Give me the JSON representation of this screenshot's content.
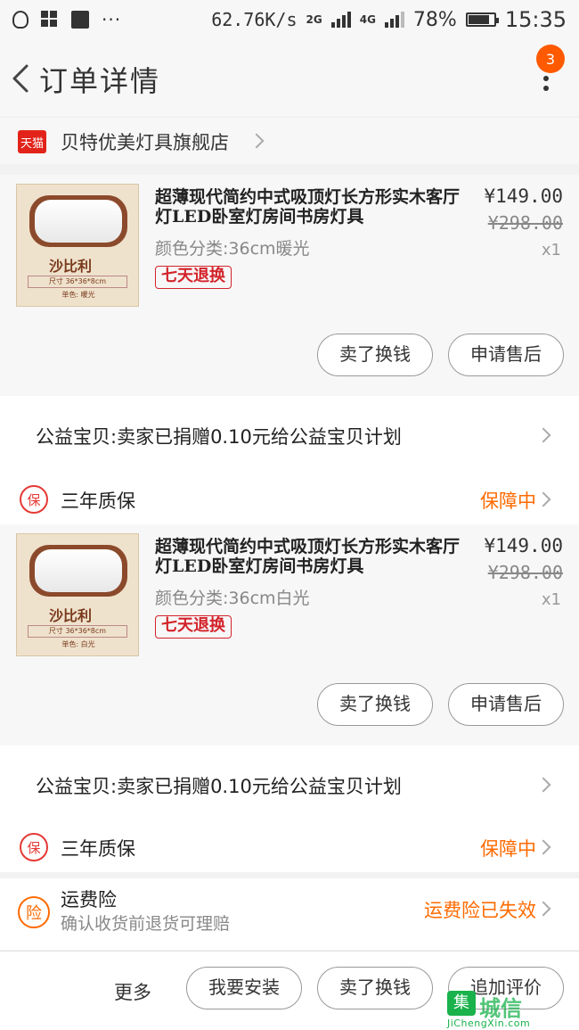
{
  "status_bar": {
    "speed": "62.76K/s",
    "net1": "2G",
    "net2": "4G",
    "battery": "78%",
    "time": "15:35"
  },
  "nav": {
    "title": "订单详情",
    "badge_count": "3"
  },
  "shop": {
    "logo_text": "天猫",
    "name": "贝特优美灯具旗舰店"
  },
  "products": [
    {
      "title": "超薄现代简约中式吸顶灯长方形实木客厅灯LED卧室灯房间书房灯具",
      "sku": "颜色分类:36cm暖光",
      "tag": "七天退换",
      "price": "¥149.00",
      "original_price": "¥298.00",
      "qty": "x1",
      "thumb_brand": "沙比利",
      "thumb_spec": "尺寸 36*36*8cm",
      "thumb_sub": "单色: 暖光",
      "btn_sell": "卖了换钱",
      "btn_aftersale": "申请售后"
    },
    {
      "title": "超薄现代简约中式吸顶灯长方形实木客厅灯LED卧室灯房间书房灯具",
      "sku": "颜色分类:36cm白光",
      "tag": "七天退换",
      "price": "¥149.00",
      "original_price": "¥298.00",
      "qty": "x1",
      "thumb_brand": "沙比利",
      "thumb_spec": "尺寸 36*36*8cm",
      "thumb_sub": "单色: 白光",
      "btn_sell": "卖了换钱",
      "btn_aftersale": "申请售后"
    }
  ],
  "charity_text": "公益宝贝:卖家已捐赠0.10元给公益宝贝计划",
  "warranty": {
    "icon_text": "保",
    "label": "三年质保",
    "status": "保障中"
  },
  "insurance": {
    "icon_text": "险",
    "title": "运费险",
    "desc": "确认收货前退货可理赔",
    "status": "运费险已失效"
  },
  "bottom": {
    "more": "更多",
    "install": "我要安装",
    "sell": "卖了换钱",
    "review": "追加评价"
  },
  "watermark": {
    "box": "集",
    "text": "城信",
    "url": "JiChengXin.com"
  },
  "colors": {
    "accent_orange": "#ff6a00",
    "tmall_red": "#e2231a",
    "tag_red": "#d3232a"
  }
}
